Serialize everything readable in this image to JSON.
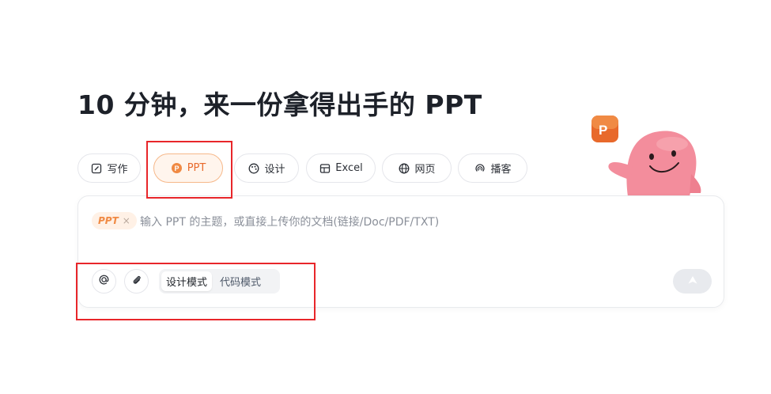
{
  "headline": "10 分钟，来一份拿得出手的 PPT",
  "tabs": [
    {
      "label": "写作",
      "icon": "pen-icon",
      "active": false
    },
    {
      "label": "PPT",
      "icon": "powerpoint-icon",
      "active": true
    },
    {
      "label": "设计",
      "icon": "palette-icon",
      "active": false
    },
    {
      "label": "Excel",
      "icon": "table-icon",
      "active": false
    },
    {
      "label": "网页",
      "icon": "globe-icon",
      "active": false
    },
    {
      "label": "播客",
      "icon": "podcast-icon",
      "active": false
    }
  ],
  "input": {
    "chip_label": "PPT",
    "chip_close": "×",
    "placeholder": "输入 PPT 的主题，或直接上传你的文档(链接/Doc/PDF/TXT)"
  },
  "toolbar": {
    "mention_icon": "at-icon",
    "attach_icon": "paperclip-icon",
    "modes": [
      "设计模式",
      "代码模式"
    ],
    "selected_mode": "设计模式",
    "send_icon": "send-icon"
  },
  "colors": {
    "accent": "#e8692b",
    "accent_bg": "#fff5ed",
    "annotation": "#e8262a",
    "mascot": "#f08a9a"
  }
}
